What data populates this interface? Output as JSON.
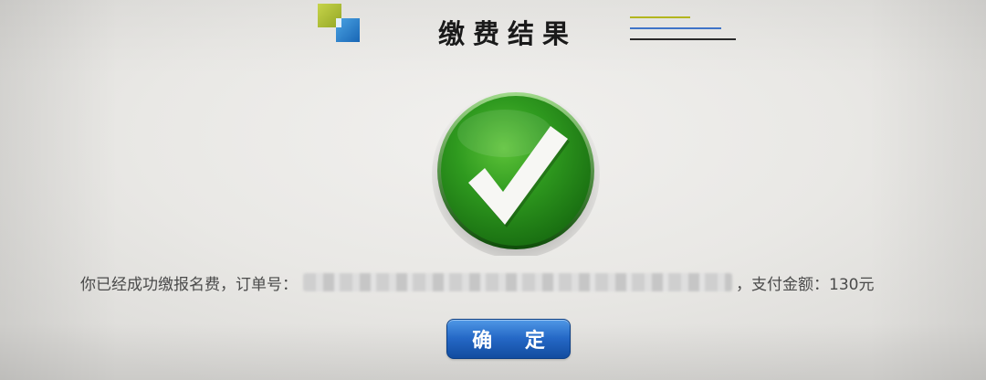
{
  "header": {
    "title": "缴费结果",
    "logo_icon": "two-squares-logo-icon",
    "colors": {
      "logo_green": "#a8b92c",
      "logo_blue": "#2a7fd0",
      "line_yellow": "#b3b51f",
      "line_blue": "#3f74c8",
      "line_dark": "#2a2a2a"
    }
  },
  "result": {
    "icon": "check-circle-icon",
    "icon_color": "#2f9a1f",
    "message_prefix": "你已经成功缴报名费，订单号：",
    "order_number_redacted": true,
    "message_suffix": "，支付金额：130元"
  },
  "actions": {
    "confirm_label": "确 定",
    "confirm_color": "#2568c6"
  }
}
